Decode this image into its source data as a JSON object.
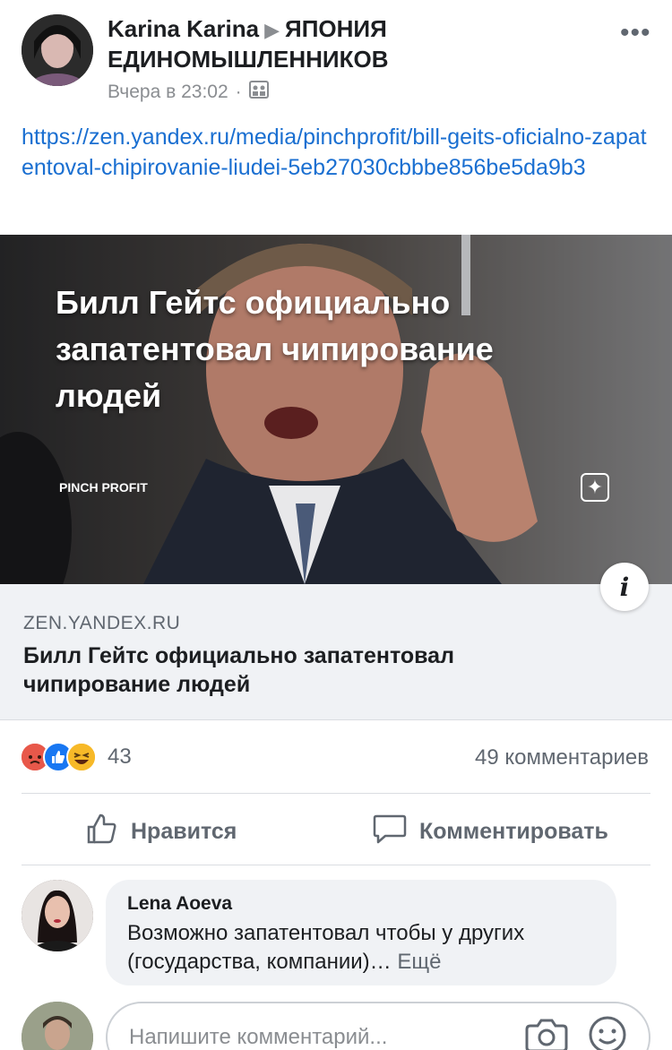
{
  "post": {
    "author": "Karina Karina",
    "group": "ЯПОНИЯ ЕДИНОМЫШЛЕННИКОВ",
    "timestamp": "Вчера в 23:02",
    "separator": "·",
    "audience_icon": "group-audience-icon",
    "link_text": "https://zen.yandex.ru/media/pinchprofit/bill-geits-oficialno-zapatentoval-chipirovanie-liudei-5eb27030cbbbe856be5da9b3"
  },
  "media": {
    "headline": "Билл Гейтс официально запатентовал чипирование людей",
    "brand": "PINCH PROFIT",
    "star_icon": "sparkle-icon",
    "info_label": "i"
  },
  "link_card": {
    "domain": "ZEN.YANDEX.RU",
    "title": "Билл Гейтс официально запатентовал чипирование людей"
  },
  "stats": {
    "reaction_icons": [
      "angry-reaction-icon",
      "like-reaction-icon",
      "haha-reaction-icon"
    ],
    "reaction_count": "43",
    "comments": "49 комментариев"
  },
  "actions": {
    "like_label": "Нравится",
    "comment_label": "Комментировать"
  },
  "comment": {
    "author": "Lena Aoeva",
    "text": "Возможно запатентовал чтобы у других (государства, компании)…",
    "more": "Ещё"
  },
  "composer": {
    "placeholder": "Напишите комментарий..."
  },
  "colors": {
    "link": "#1a6fd1",
    "like_blue": "#1877f2",
    "angry": "#e8584a",
    "haha": "#f7b928",
    "muted": "#606770"
  }
}
